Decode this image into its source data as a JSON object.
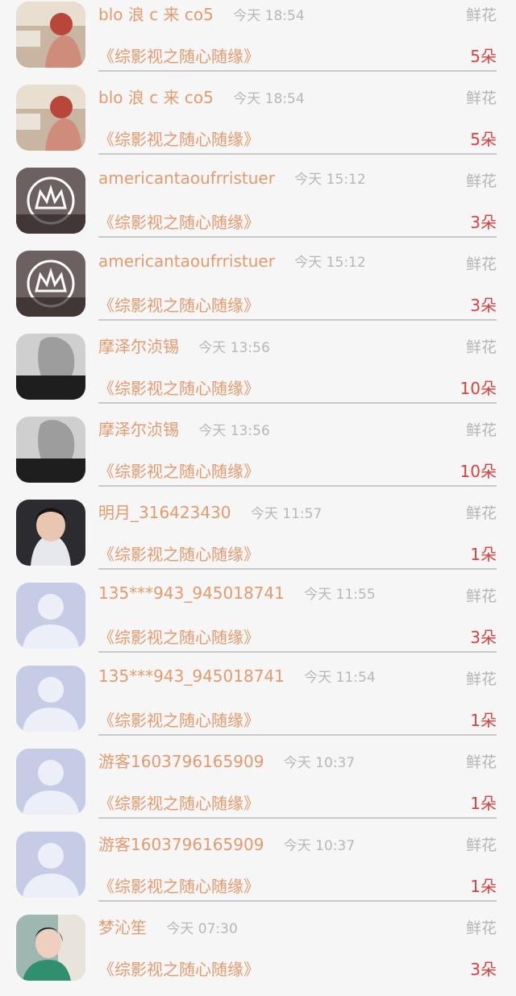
{
  "gift_rows": [
    {
      "user": "blo 浪 c 来 co5",
      "time": "今天 18:54",
      "gift": "鲜花",
      "book": "《综影视之随心随缘》",
      "count": "5朵",
      "avatar": "photo-red"
    },
    {
      "user": "blo 浪 c 来 co5",
      "time": "今天 18:54",
      "gift": "鲜花",
      "book": "《综影视之随心随缘》",
      "count": "5朵",
      "avatar": "photo-red"
    },
    {
      "user": "americantaoufrristuer",
      "time": "今天 15:12",
      "gift": "鲜花",
      "book": "《综影视之随心随缘》",
      "count": "3朵",
      "avatar": "photo-crown"
    },
    {
      "user": "americantaoufrristuer",
      "time": "今天 15:12",
      "gift": "鲜花",
      "book": "《综影视之随心随缘》",
      "count": "3朵",
      "avatar": "photo-crown"
    },
    {
      "user": "摩泽尔浈锡",
      "time": "今天 13:56",
      "gift": "鲜花",
      "book": "《综影视之随心随缘》",
      "count": "10朵",
      "avatar": "photo-gray"
    },
    {
      "user": "摩泽尔浈锡",
      "time": "今天 13:56",
      "gift": "鲜花",
      "book": "《综影视之随心随缘》",
      "count": "10朵",
      "avatar": "photo-gray"
    },
    {
      "user": "明月_316423430",
      "time": "今天 11:57",
      "gift": "鲜花",
      "book": "《综影视之随心随缘》",
      "count": "1朵",
      "avatar": "photo-girl"
    },
    {
      "user": "135***943_945018741",
      "time": "今天 11:55",
      "gift": "鲜花",
      "book": "《综影视之随心随缘》",
      "count": "3朵",
      "avatar": "default-avatar"
    },
    {
      "user": "135***943_945018741",
      "time": "今天 11:54",
      "gift": "鲜花",
      "book": "《综影视之随心随缘》",
      "count": "1朵",
      "avatar": "default-avatar"
    },
    {
      "user": "游客1603796165909",
      "time": "今天 10:37",
      "gift": "鲜花",
      "book": "《综影视之随心随缘》",
      "count": "1朵",
      "avatar": "default-avatar"
    },
    {
      "user": "游客1603796165909",
      "time": "今天 10:37",
      "gift": "鲜花",
      "book": "《综影视之随心随缘》",
      "count": "1朵",
      "avatar": "default-avatar"
    },
    {
      "user": "梦沁笙",
      "time": "今天 07:30",
      "gift": "鲜花",
      "book": "《综影视之随心随缘》",
      "count": "3朵",
      "avatar": "photo-teal"
    }
  ],
  "colors": {
    "username": "#e59a6e",
    "count": "#d9413f",
    "muted": "#b7b7b7",
    "background": "#f6f6f6"
  }
}
